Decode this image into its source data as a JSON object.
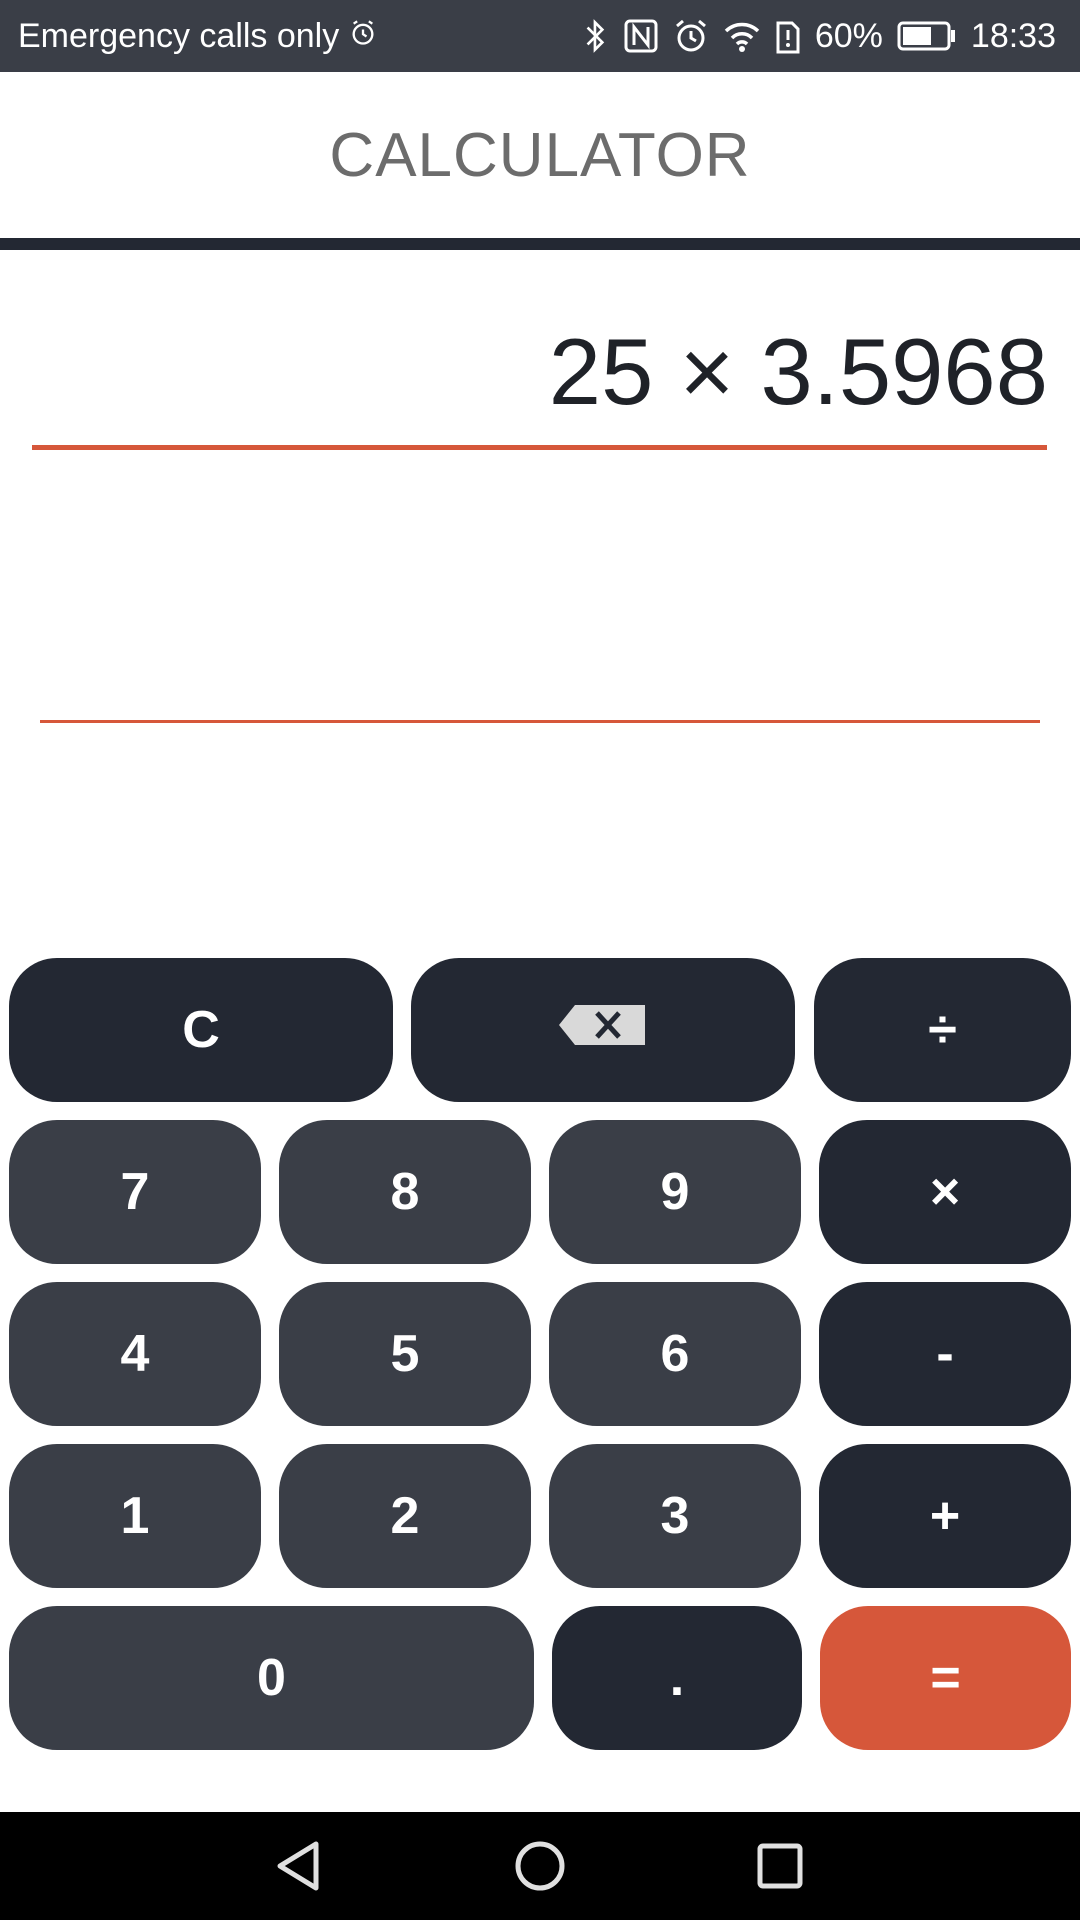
{
  "status_bar": {
    "carrier": "Emergency calls only",
    "battery": "60%",
    "time": "18:33"
  },
  "header": {
    "title": "CALCULATOR"
  },
  "display": {
    "expression": "25 × 3.5968",
    "result": ""
  },
  "keypad": {
    "clear": "C",
    "divide": "÷",
    "seven": "7",
    "eight": "8",
    "nine": "9",
    "multiply": "×",
    "four": "4",
    "five": "5",
    "six": "6",
    "minus": "-",
    "one": "1",
    "two": "2",
    "three": "3",
    "plus": "+",
    "zero": "0",
    "dot": ".",
    "equals": "="
  },
  "colors": {
    "accent": "#d6573a",
    "number_key": "#3a3e47",
    "operator_key": "#232833",
    "status_bar": "#3a3e47"
  },
  "icons": {
    "backspace": "backspace-icon",
    "bluetooth": "bluetooth-icon",
    "nfc": "nfc-icon",
    "alarm": "alarm-icon",
    "wifi": "wifi-icon",
    "battery_alert": "battery-alert-icon",
    "battery": "battery-icon",
    "nav_back": "back-icon",
    "nav_home": "home-icon",
    "nav_recents": "recents-icon"
  }
}
